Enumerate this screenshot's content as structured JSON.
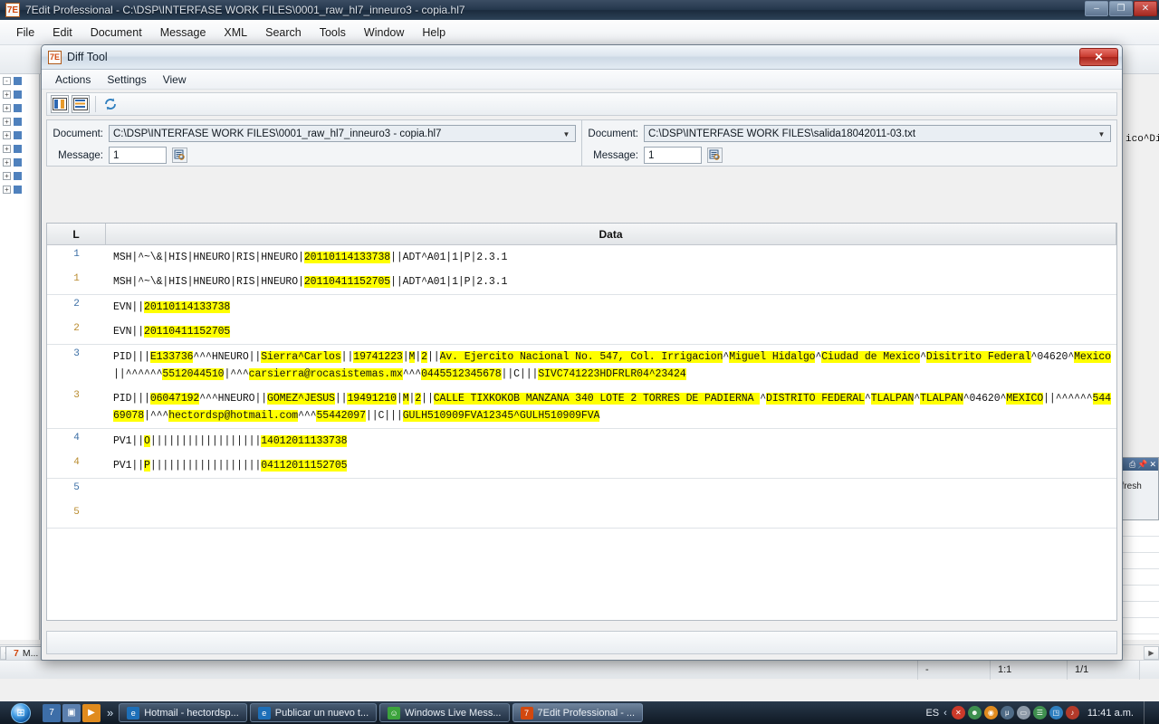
{
  "app": {
    "title": "7Edit Professional - C:\\DSP\\INTERFASE WORK FILES\\0001_raw_hl7_inneuro3 - copia.hl7",
    "icon": "7edit-icon",
    "window_buttons": {
      "minimize": "–",
      "maximize": "❐",
      "close": "✕"
    },
    "menu": [
      "File",
      "Edit",
      "Document",
      "Message",
      "XML",
      "Search",
      "Tools",
      "Window",
      "Help"
    ],
    "background_text": [
      "ico^Di",
      "efresh"
    ],
    "status": {
      "left": "",
      "cell1": "-",
      "cell2": "1:1",
      "cell3": "1/1"
    },
    "doc_tab": "M..."
  },
  "diff": {
    "title": "Diff Tool",
    "icon": "7edit-icon",
    "close_label": "✕",
    "menu": [
      "Actions",
      "Settings",
      "View"
    ],
    "toolbar": [
      {
        "name": "side-by-side-view-button",
        "glyph": "▮▮"
      },
      {
        "name": "inline-view-button",
        "glyph": "≡"
      },
      {
        "name": "refresh-button",
        "glyph": "↻"
      }
    ],
    "left": {
      "document_label": "Document:",
      "document_value": "C:\\DSP\\INTERFASE WORK FILES\\0001_raw_hl7_inneuro3 - copia.hl7",
      "message_label": "Message:",
      "message_value": "1"
    },
    "right": {
      "document_label": "Document:",
      "document_value": "C:\\DSP\\INTERFASE WORK FILES\\salida18042011-03.txt",
      "message_label": "Message:",
      "message_value": "1"
    },
    "grid": {
      "columns": [
        "L",
        "Data"
      ],
      "rows": [
        {
          "line": "1",
          "side": "a",
          "segments": [
            {
              "t": "MSH|^~\\&|HIS|HNEURO|RIS|HNEURO|",
              "h": false
            },
            {
              "t": "20110114133738",
              "h": true
            },
            {
              "t": "||ADT^A01|1|P|2.3.1",
              "h": false
            }
          ]
        },
        {
          "line": "1",
          "side": "b",
          "last": true,
          "segments": [
            {
              "t": "MSH|^~\\&|HIS|HNEURO|RIS|HNEURO|",
              "h": false
            },
            {
              "t": "20110411152705",
              "h": true
            },
            {
              "t": "||ADT^A01|1|P|2.3.1",
              "h": false
            }
          ]
        },
        {
          "line": "2",
          "side": "a",
          "segments": [
            {
              "t": "EVN||",
              "h": false
            },
            {
              "t": "20110114133738",
              "h": true
            }
          ]
        },
        {
          "line": "2",
          "side": "b",
          "last": true,
          "segments": [
            {
              "t": "EVN||",
              "h": false
            },
            {
              "t": "20110411152705",
              "h": true
            }
          ]
        },
        {
          "line": "3",
          "side": "a",
          "segments": [
            {
              "t": "PID|||",
              "h": false
            },
            {
              "t": "E133736",
              "h": true
            },
            {
              "t": "^^^HNEURO||",
              "h": false
            },
            {
              "t": "Sierra^Carlos",
              "h": true
            },
            {
              "t": "||",
              "h": false
            },
            {
              "t": "19741223",
              "h": true
            },
            {
              "t": "|",
              "h": false
            },
            {
              "t": "M",
              "h": true
            },
            {
              "t": "|",
              "h": false
            },
            {
              "t": "2",
              "h": true
            },
            {
              "t": "||",
              "h": false
            },
            {
              "t": "Av. Ejercito Nacional No. 547, Col. Irrigacion",
              "h": true
            },
            {
              "t": "^",
              "h": false
            },
            {
              "t": "Miguel Hidalgo",
              "h": true
            },
            {
              "t": "^",
              "h": false
            },
            {
              "t": "Ciudad de Mexico",
              "h": true
            },
            {
              "t": "^",
              "h": false
            },
            {
              "t": "Disitrito Federal",
              "h": true
            },
            {
              "t": "^04620^",
              "h": false
            },
            {
              "t": "Mexico",
              "h": true
            },
            {
              "t": "||^^^^^^",
              "h": false
            },
            {
              "t": "5512044510",
              "h": true
            },
            {
              "t": "|^^^",
              "h": false
            },
            {
              "t": "carsierra@rocasistemas.mx",
              "h": true
            },
            {
              "t": "^^^",
              "h": false
            },
            {
              "t": "0445512345678",
              "h": true
            },
            {
              "t": "||C|||",
              "h": false
            },
            {
              "t": "SIVC741223HDFRLR04^23424",
              "h": true
            }
          ]
        },
        {
          "line": "3",
          "side": "b",
          "last": true,
          "segments": [
            {
              "t": "PID|||",
              "h": false
            },
            {
              "t": "06047192",
              "h": true
            },
            {
              "t": "^^^HNEURO||",
              "h": false
            },
            {
              "t": "GOMEZ^JESUS",
              "h": true
            },
            {
              "t": "||",
              "h": false
            },
            {
              "t": "19491210",
              "h": true
            },
            {
              "t": "|",
              "h": false
            },
            {
              "t": "M",
              "h": true
            },
            {
              "t": "|",
              "h": false
            },
            {
              "t": "2",
              "h": true
            },
            {
              "t": "||",
              "h": false
            },
            {
              "t": "CALLE TIXKOKOB MANZANA 340 LOTE 2 TORRES DE PADIERNA ",
              "h": true
            },
            {
              "t": "^",
              "h": false
            },
            {
              "t": "DISTRITO FEDERAL",
              "h": true
            },
            {
              "t": "^",
              "h": false
            },
            {
              "t": "TLALPAN",
              "h": true
            },
            {
              "t": "^",
              "h": false
            },
            {
              "t": "TLALPAN",
              "h": true
            },
            {
              "t": "^04620^",
              "h": false
            },
            {
              "t": "MEXICO",
              "h": true
            },
            {
              "t": "||^^^^^^",
              "h": false
            },
            {
              "t": "54469078",
              "h": true
            },
            {
              "t": "|^^^",
              "h": false
            },
            {
              "t": "hectordsp@hotmail.com",
              "h": true
            },
            {
              "t": "^^^",
              "h": false
            },
            {
              "t": "55442097",
              "h": true
            },
            {
              "t": "||C|||",
              "h": false
            },
            {
              "t": "GULH510909FVA12345^GULH510909FVA",
              "h": true
            }
          ]
        },
        {
          "line": "4",
          "side": "a",
          "segments": [
            {
              "t": "PV1||",
              "h": false
            },
            {
              "t": "O",
              "h": true
            },
            {
              "t": "||||||||||||||||||",
              "h": false
            },
            {
              "t": "14012011133738",
              "h": true
            }
          ]
        },
        {
          "line": "4",
          "side": "b",
          "last": true,
          "segments": [
            {
              "t": "PV1||",
              "h": false
            },
            {
              "t": "P",
              "h": true
            },
            {
              "t": "||||||||||||||||||",
              "h": false
            },
            {
              "t": "04112011152705",
              "h": true
            }
          ]
        },
        {
          "line": "5",
          "side": "a",
          "segments": []
        },
        {
          "line": "5",
          "side": "b",
          "last": true,
          "segments": []
        }
      ]
    }
  },
  "taskbar": {
    "start_label": "⊞",
    "quicklaunch": [
      {
        "name": "quicklaunch-7edit-icon",
        "glyph": "7",
        "color": "#3d6ea8"
      },
      {
        "name": "quicklaunch-showdesktop-icon",
        "glyph": "▣",
        "color": "#5b7fae"
      },
      {
        "name": "quicklaunch-media-icon",
        "glyph": "▶",
        "color": "#e08b1e"
      }
    ],
    "overflow": "»",
    "items": [
      {
        "label": "Hotmail - hectordsp...",
        "icon": "internet-explorer-icon",
        "icon_glyph": "e",
        "icon_color": "#1d6fb8",
        "active": false
      },
      {
        "label": "Publicar un nuevo t...",
        "icon": "internet-explorer-icon",
        "icon_glyph": "e",
        "icon_color": "#1d6fb8",
        "active": false
      },
      {
        "label": "Windows Live Mess...",
        "icon": "messenger-icon",
        "icon_glyph": "☺",
        "icon_color": "#3ca33c",
        "active": false
      },
      {
        "label": "7Edit Professional - ...",
        "icon": "7edit-icon",
        "icon_glyph": "7",
        "icon_color": "#d2480f",
        "active": true
      }
    ],
    "tray": {
      "language": "ES",
      "chevron": "‹",
      "icons": [
        {
          "name": "action-center-error-icon",
          "glyph": "✕",
          "color": "#cc3a2a"
        },
        {
          "name": "network-people-icon",
          "glyph": "☻",
          "color": "#3d8f4f"
        },
        {
          "name": "antivirus-icon",
          "glyph": "◉",
          "color": "#e08b1e"
        },
        {
          "name": "utorrent-icon",
          "glyph": "μ",
          "color": "#4f6b86"
        },
        {
          "name": "monitor-icon",
          "glyph": "▭",
          "color": "#8e9aa8"
        },
        {
          "name": "clipboard-icon",
          "glyph": "☰",
          "color": "#3f8f4f"
        },
        {
          "name": "network-icon",
          "glyph": "◳",
          "color": "#2f7fbf"
        },
        {
          "name": "volume-muted-icon",
          "glyph": "♪",
          "color": "#b33a2a"
        }
      ],
      "clock": "11:41 a.m."
    }
  }
}
